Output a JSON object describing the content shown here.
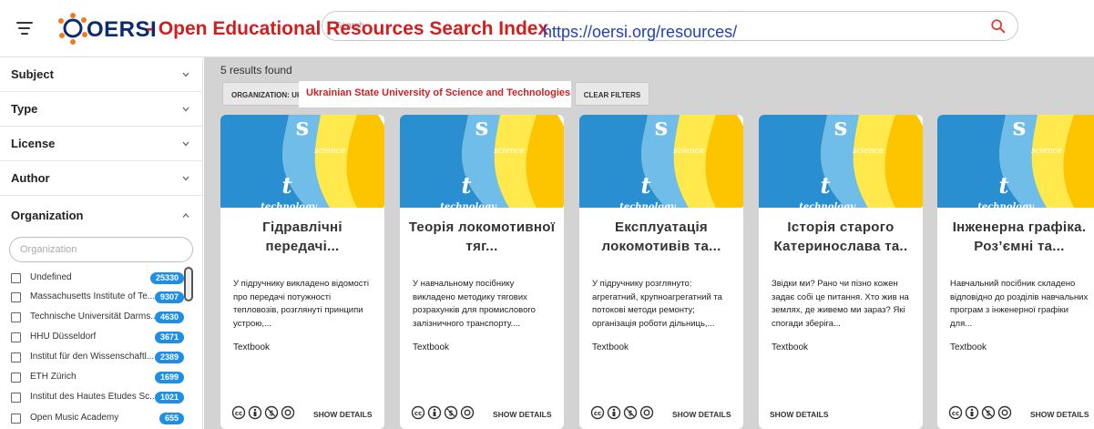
{
  "header": {
    "logo_text": "OERSI",
    "search_placeholder": "Search",
    "overlay_title": "- Open Educational Resources Search Index",
    "overlay_url": "https://oersi.org/resources/"
  },
  "sidebar": {
    "facets": [
      {
        "label": "Subject",
        "expanded": false
      },
      {
        "label": "Type",
        "expanded": false
      },
      {
        "label": "License",
        "expanded": false
      },
      {
        "label": "Author",
        "expanded": false
      },
      {
        "label": "Organization",
        "expanded": true
      }
    ],
    "org_placeholder": "Organization",
    "organizations": [
      {
        "name": "Undefined",
        "count": "25330"
      },
      {
        "name": "Massachusetts Institute of Te...",
        "count": "9307"
      },
      {
        "name": "Technische Universität Darms...",
        "count": "4630"
      },
      {
        "name": "HHU Düsseldorf",
        "count": "3671"
      },
      {
        "name": "Institut für den Wissenschaftl...",
        "count": "2389"
      },
      {
        "name": "ETH Zürich",
        "count": "1699"
      },
      {
        "name": "Institut des Hautes Études Sc...",
        "count": "1021"
      },
      {
        "name": "Open Music Academy",
        "count": "655"
      }
    ]
  },
  "main": {
    "results_text": "5 results found",
    "filter_chip": "ORGANIZATION: Ukrainian State University of Science and Technologies",
    "filter_highlight": "Ukrainian State University of Science and Technologies",
    "clear_label": "CLEAR FILTERS",
    "cards": [
      {
        "title": "Гідравлічні передачі...",
        "description": "У підручнику викладено відомості про передачі потужності тепловозів, розглянуті принципи устрою,...",
        "type": "Textbook",
        "details": "SHOW DETAILS",
        "license": true
      },
      {
        "title": "Теорія локомотивної тяг...",
        "description": "У навчальному посібнику викладено методику тягових розрахунків для промислового залізничного транспорту....",
        "type": "Textbook",
        "details": "SHOW DETAILS",
        "license": true
      },
      {
        "title": "Експлуатація локомотивів та...",
        "description": "У підручнику розглянуто: агрегатний, крупноагрегатний та потокові методи ремонту; організація роботи дільниць,...",
        "type": "Textbook",
        "details": "SHOW DETAILS",
        "license": true
      },
      {
        "title": "Історія старого Катеринослава та..",
        "description": "Звідки ми? Рано чи пізно кожен задає собі це питання. Хто жив на землях, де живемо ми зараз? Які спогади зберіга...",
        "type": "Textbook",
        "details": "SHOW DETAILS",
        "license": false
      },
      {
        "title": "Інженерна графіка. Роз’ємні та...",
        "description": "Навчальний посібник складено відповідно до розділів навчальних програм з інженерної графіки для...",
        "type": "Textbook",
        "details": "SHOW DETAILS",
        "license": true
      }
    ],
    "thumb_word_top": "science",
    "thumb_letter": "t",
    "thumb_word_bottom": "technology"
  }
}
